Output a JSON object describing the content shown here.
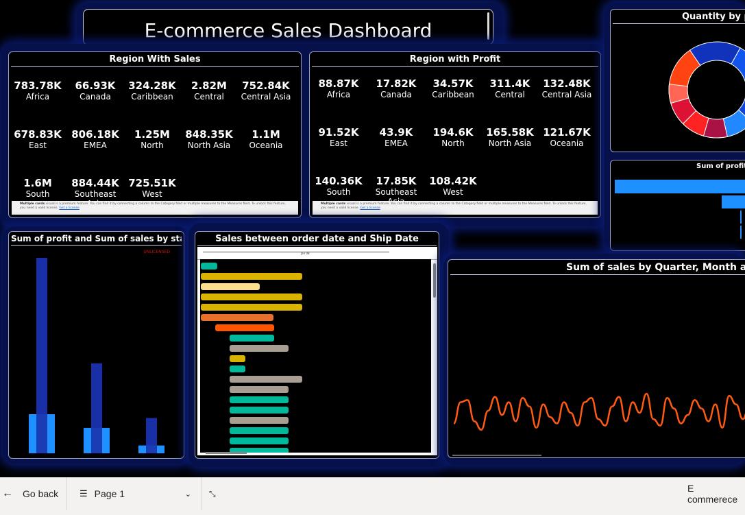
{
  "title": "E-commerce Sales Dashboard",
  "region_sales": {
    "title": "Region With Sales",
    "cards": [
      {
        "value": "783.78K",
        "label": "Africa"
      },
      {
        "value": "66.93K",
        "label": "Canada"
      },
      {
        "value": "324.28K",
        "label": "Caribbean"
      },
      {
        "value": "2.82M",
        "label": "Central"
      },
      {
        "value": "752.84K",
        "label": "Central Asia"
      },
      {
        "value": "678.83K",
        "label": "East"
      },
      {
        "value": "806.18K",
        "label": "EMEA"
      },
      {
        "value": "1.25M",
        "label": "North"
      },
      {
        "value": "848.35K",
        "label": "North Asia"
      },
      {
        "value": "1.1M",
        "label": "Oceania"
      },
      {
        "value": "1.6M",
        "label": "South"
      },
      {
        "value": "884.44K",
        "label": "Southeast Asia"
      },
      {
        "value": "725.51K",
        "label": "West"
      }
    ],
    "warning_bold": "Multiple cards",
    "warning_text": "visual is a premium feature. You can find it by connecting a column to the Category field or multiple measures to the Measures field. To unlock this feature, you need a valid license.",
    "warning_link": "Get a license"
  },
  "region_profit": {
    "title": "Region with Profit",
    "cards": [
      {
        "value": "88.87K",
        "label": "Africa"
      },
      {
        "value": "17.82K",
        "label": "Canada"
      },
      {
        "value": "34.57K",
        "label": "Caribbean"
      },
      {
        "value": "311.4K",
        "label": "Central"
      },
      {
        "value": "132.48K",
        "label": "Central Asia"
      },
      {
        "value": "91.52K",
        "label": "East"
      },
      {
        "value": "43.9K",
        "label": "EMEA"
      },
      {
        "value": "194.6K",
        "label": "North"
      },
      {
        "value": "165.58K",
        "label": "North Asia"
      },
      {
        "value": "121.67K",
        "label": "Oceania"
      },
      {
        "value": "140.36K",
        "label": "South"
      },
      {
        "value": "17.85K",
        "label": "Southeast Asia"
      },
      {
        "value": "108.42K",
        "label": "West"
      }
    ],
    "warning_bold": "Multiple cards",
    "warning_text": "visual is a premium feature. You can find it by connecting a column to the Category field or multiple measures to the Measures field. To unlock this feature, you need a valid license.",
    "warning_link": "Get a license"
  },
  "quantity_donut": {
    "title": "Quantity by pro",
    "colors": [
      "#20d020",
      "#ff4411",
      "#1133bb",
      "#1155ee",
      "#1144dd",
      "#2288ff",
      "#aa1144",
      "#ff2222",
      "#dd1133",
      "#ff6655"
    ]
  },
  "profit_bar": {
    "title": "Sum of profit by p",
    "color": "#1e90ff"
  },
  "state_chart": {
    "title": "Sum of profit and Sum of sales by state",
    "badge": "UNLICENSED",
    "color_sales": "#1a2fa8",
    "color_profit": "#1e90ff"
  },
  "gantt": {
    "title": "Sales between order date and Ship Date",
    "header_label": "Jan 08",
    "colors": [
      "#00b89c",
      "#d9b300",
      "#ffe08a",
      "#e8702a",
      "#ff5500",
      "#a89e92"
    ]
  },
  "timeline": {
    "title": "Sum of sales by Quarter, Month and Da",
    "line_color": "#ff5a14"
  },
  "chart_data": [
    {
      "type": "bar",
      "title": "Sum of profit and Sum of sales by state",
      "series": [
        {
          "values": [
            1,
            0.46,
            0.18
          ]
        },
        {
          "values": [
            0.2,
            0.13,
            0.04
          ]
        }
      ]
    },
    {
      "type": "line",
      "title": "Sum of sales by Quarter, Month and Da",
      "values": [
        10,
        30,
        32,
        12,
        4,
        22,
        35,
        18,
        30,
        12,
        34,
        26,
        6,
        28,
        16,
        10,
        30,
        20,
        8,
        30,
        34,
        14,
        8,
        26,
        35,
        12,
        30,
        20,
        38,
        14,
        8,
        34,
        24,
        10,
        18,
        32,
        24,
        12,
        28,
        6,
        36,
        28,
        14,
        30
      ]
    }
  ],
  "bottom_bar": {
    "back_label": "Go back",
    "page_label": "Page 1",
    "report_name": "E commerece"
  }
}
